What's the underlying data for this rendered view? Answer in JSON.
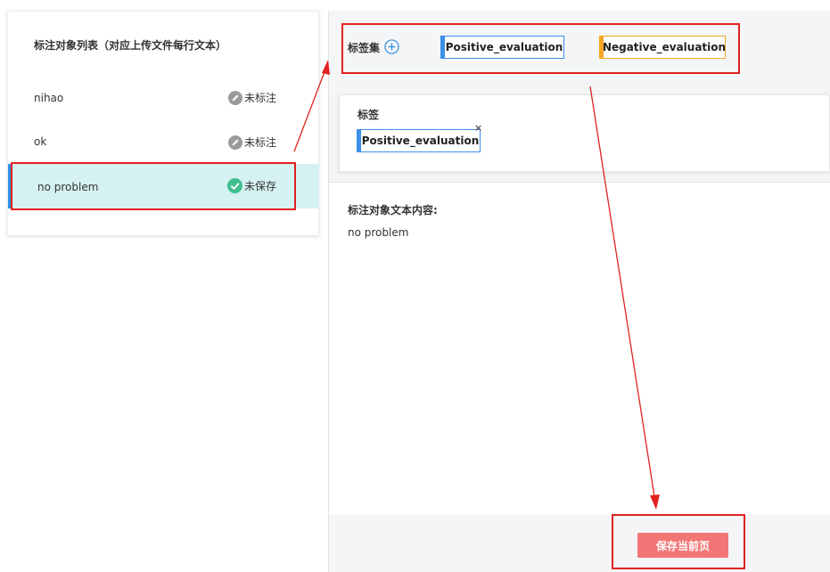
{
  "object_list": {
    "title": "标注对象列表（对应上传文件每行文本）",
    "rows": [
      {
        "text": "nihao",
        "status": "未标注",
        "status_icon": "edit-icon"
      },
      {
        "text": "ok",
        "status": "未标注",
        "status_icon": "edit-icon"
      },
      {
        "text": "no problem",
        "status": "未保存",
        "status_icon": "check-icon",
        "selected": true
      }
    ]
  },
  "tagset": {
    "label": "标签集",
    "tags": [
      "Positive_evaluation",
      "Negative_evaluation"
    ]
  },
  "label_card": {
    "title": "标签",
    "selected_tag": "Positive_evaluation",
    "remove_symbol": "×"
  },
  "content": {
    "title": "标注对象文本内容:",
    "text": "no problem"
  },
  "footer": {
    "save_label": "保存当前页"
  },
  "colors": {
    "positive": "#3b8fe8",
    "negative": "#f5a623",
    "selected_row": "#d5f1f1",
    "save_button": "#f27676",
    "annotation": "#e0221f",
    "check": "#3fbf8f"
  }
}
